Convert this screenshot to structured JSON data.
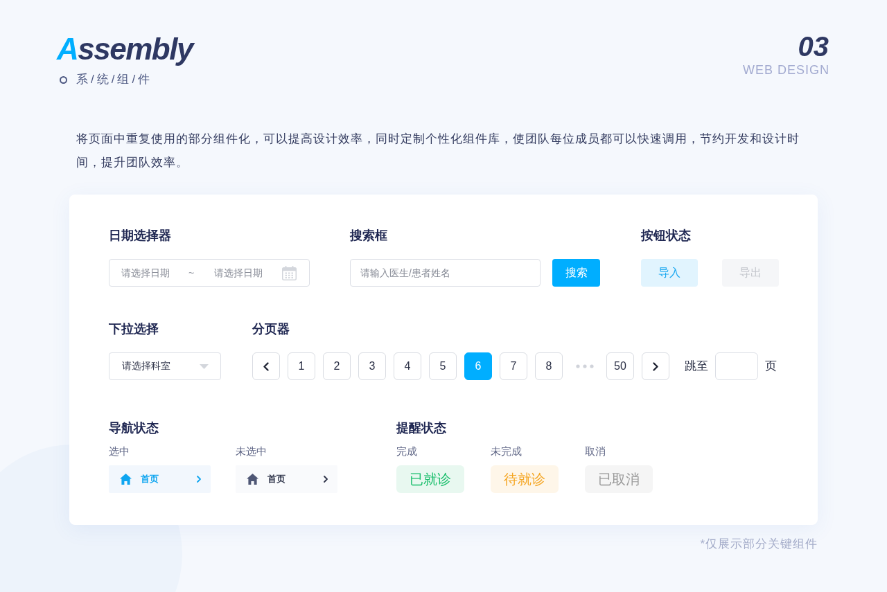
{
  "header": {
    "logo": {
      "first_letter": "A",
      "rest": "ssembly"
    },
    "subtitle": "系/统/组/件",
    "page_number": "03",
    "caption": "WEB DESIGN"
  },
  "intro": "将页面中重复使用的部分组件化，可以提高设计效率，同时定制个性化组件库，使团队每位成员都可以快速调用，节约开发和设计时间，提升团队效率。",
  "date_picker": {
    "title": "日期选择器",
    "start_placeholder": "请选择日期",
    "separator": "~",
    "end_placeholder": "请选择日期"
  },
  "search": {
    "title": "搜索框",
    "placeholder": "请输入医生/患者姓名",
    "button": "搜索"
  },
  "button_states": {
    "title": "按钮状态",
    "buttons": [
      {
        "label": "导入",
        "disabled": false
      },
      {
        "label": "导出",
        "disabled": true
      }
    ]
  },
  "dropdown": {
    "title": "下拉选择",
    "placeholder": "请选择科室"
  },
  "pagination": {
    "title": "分页器",
    "pages": [
      {
        "kind": "page",
        "label": "1",
        "selected": false
      },
      {
        "kind": "page",
        "label": "2",
        "selected": false
      },
      {
        "kind": "page",
        "label": "3",
        "selected": false
      },
      {
        "kind": "page",
        "label": "4",
        "selected": false
      },
      {
        "kind": "page",
        "label": "5",
        "selected": false
      },
      {
        "kind": "page",
        "label": "6",
        "selected": true
      },
      {
        "kind": "page",
        "label": "7",
        "selected": false
      },
      {
        "kind": "page",
        "label": "8",
        "selected": false
      },
      {
        "kind": "ellipsis"
      },
      {
        "kind": "page",
        "label": "50",
        "selected": false
      }
    ],
    "jump_label": "跳至",
    "jump_suffix": "页"
  },
  "navigation": {
    "title": "导航状态",
    "items": [
      {
        "caption": "选中",
        "label": "首页",
        "selected": true
      },
      {
        "caption": "未选中",
        "label": "首页",
        "selected": false
      }
    ]
  },
  "reminders": {
    "title": "提醒状态",
    "items": [
      {
        "caption": "完成",
        "label": "已就诊",
        "color": "#1dbf6e"
      },
      {
        "caption": "未完成",
        "label": "待就诊",
        "color": "#f5a623"
      },
      {
        "caption": "取消",
        "label": "已取消",
        "color": "#999999"
      }
    ]
  },
  "footnote": "*仅展示部分关键组件"
}
